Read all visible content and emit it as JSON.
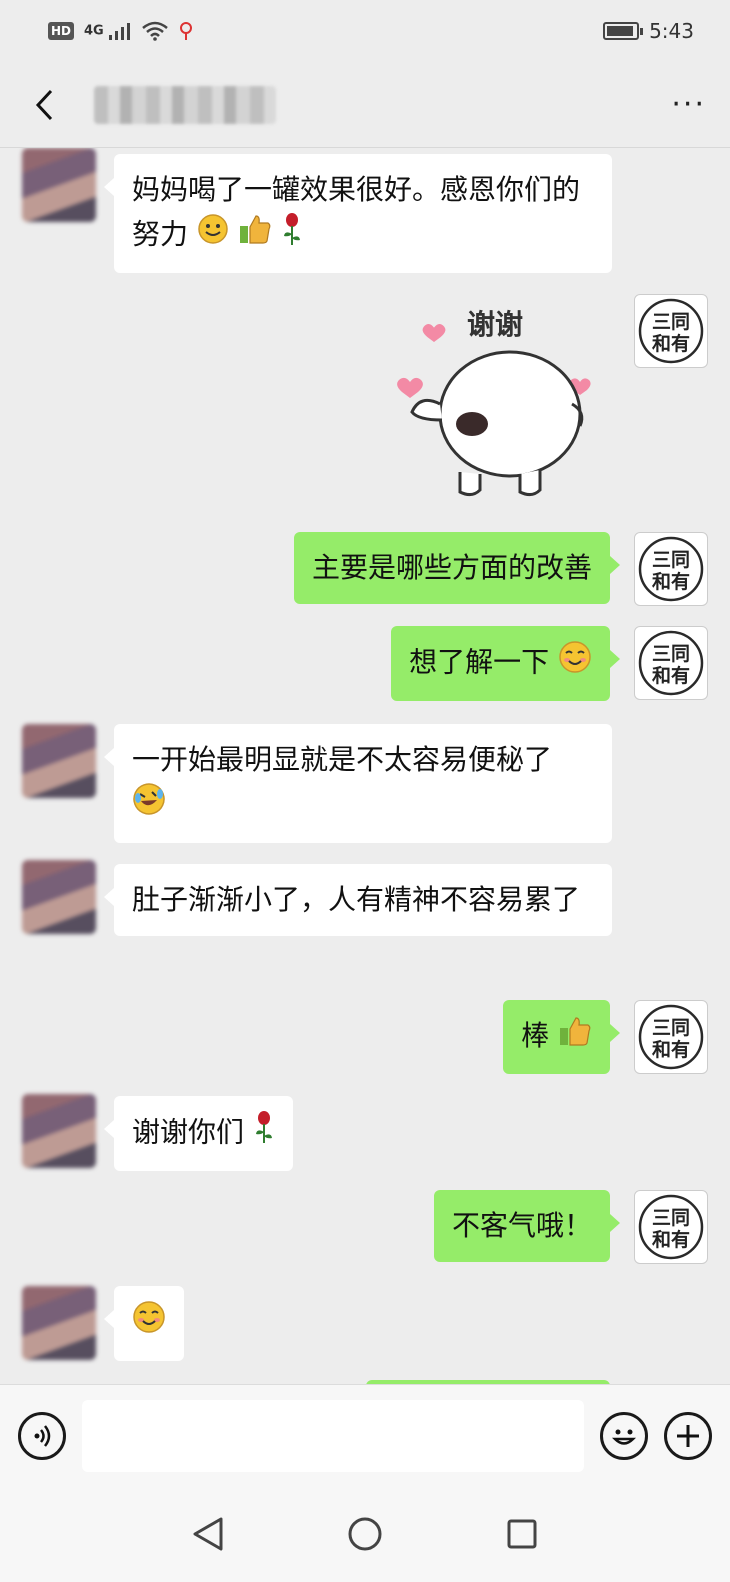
{
  "status_bar": {
    "hd": "HD",
    "network": "4G",
    "time": "5:43"
  },
  "header": {
    "title": "",
    "more": "···"
  },
  "messages": [
    {
      "side": "left",
      "text": "妈妈喝了一罐效果很好。感恩你们的努力"
    },
    {
      "side": "right",
      "type": "sticker",
      "text": "谢谢"
    },
    {
      "side": "right",
      "text": "主要是哪些方面的改善"
    },
    {
      "side": "right",
      "text": "想了解一下"
    },
    {
      "side": "left",
      "text": "一开始最明显就是不太容易便秘了"
    },
    {
      "side": "left",
      "text": "肚子渐渐小了，人有精神不容易累了"
    },
    {
      "side": "right",
      "text": "棒"
    },
    {
      "side": "left",
      "text": "谢谢你们"
    },
    {
      "side": "right",
      "text": "不客气哦！"
    },
    {
      "side": "left",
      "text": ""
    }
  ],
  "self_avatar": {
    "line1": "三同",
    "line2": "和有"
  },
  "input": {
    "placeholder": "",
    "value": ""
  },
  "colors": {
    "self_bubble": "#95ec69",
    "other_bubble": "#ffffff",
    "background": "#ededed"
  },
  "icons": [
    "back-icon",
    "more-icon",
    "voice-icon",
    "emoji-icon",
    "plus-icon",
    "nav-back-icon",
    "nav-home-icon",
    "nav-recent-icon"
  ]
}
